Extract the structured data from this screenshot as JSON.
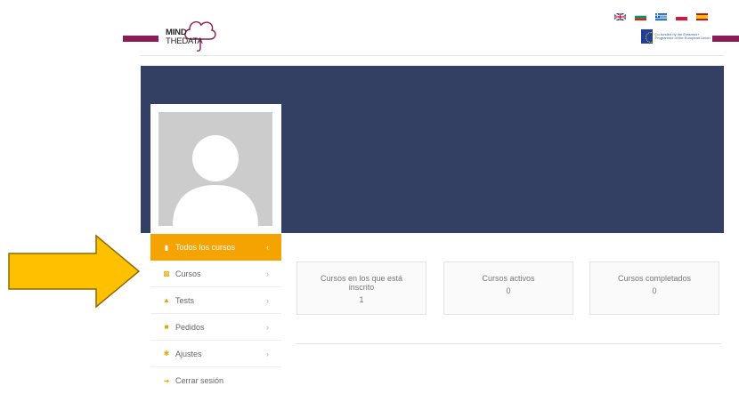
{
  "header": {
    "logo": {
      "line1": "MIND",
      "line2": "THEDATA"
    },
    "languages": [
      "en-flag",
      "bg-flag",
      "el-flag",
      "pl-flag",
      "es-flag"
    ],
    "eu_notice": {
      "icon": "eu-flag-icon",
      "text": "Co-funded by the Erasmus+ Programme of the European Union"
    }
  },
  "colors": {
    "banner": "#333f63",
    "accent": "#f4a300",
    "brand": "#8a1c56",
    "arrow": "#ffc000"
  },
  "sidebar": {
    "items": [
      {
        "label": "Todos los cursos",
        "icon": "chat-icon",
        "active": true
      },
      {
        "label": "Cursos",
        "icon": "book-icon",
        "active": false
      },
      {
        "label": "Tests",
        "icon": "puzzle-icon",
        "active": false
      },
      {
        "label": "Pedidos",
        "icon": "cart-icon",
        "active": false
      },
      {
        "label": "Ajustes",
        "icon": "gear-icon",
        "active": false
      },
      {
        "label": "Cerrar sesión",
        "icon": "logout-icon",
        "active": false
      }
    ]
  },
  "stats": [
    {
      "label": "Cursos en los que está inscrito",
      "value": "1"
    },
    {
      "label": "Cursos activos",
      "value": "0"
    },
    {
      "label": "Cursos completados",
      "value": "0"
    }
  ]
}
